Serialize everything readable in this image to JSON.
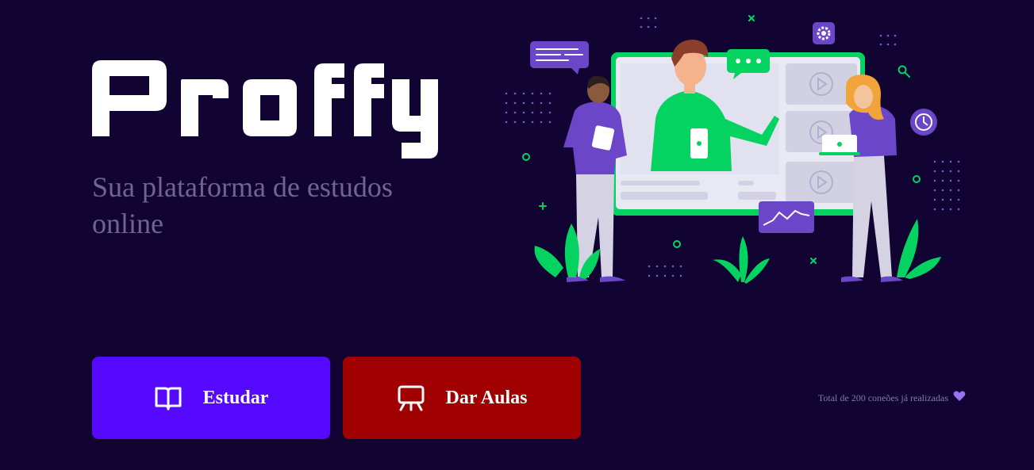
{
  "brand": {
    "name": "Proffy",
    "tagline": "Sua plataforma de estudos online"
  },
  "actions": {
    "study_label": "Estudar",
    "teach_label": "Dar Aulas"
  },
  "footer": {
    "connections_text": "Total de 200 coneões já realizadas"
  },
  "icons": {
    "study": "book-open-icon",
    "teach": "presentation-board-icon",
    "connections": "purple-heart-icon"
  },
  "colors": {
    "background": "#110432",
    "study_button": "#5509ff",
    "teach_button": "#a00000",
    "accent_green": "#04d361",
    "accent_purple": "#6b46c8",
    "tagline_text": "#6e6592"
  }
}
